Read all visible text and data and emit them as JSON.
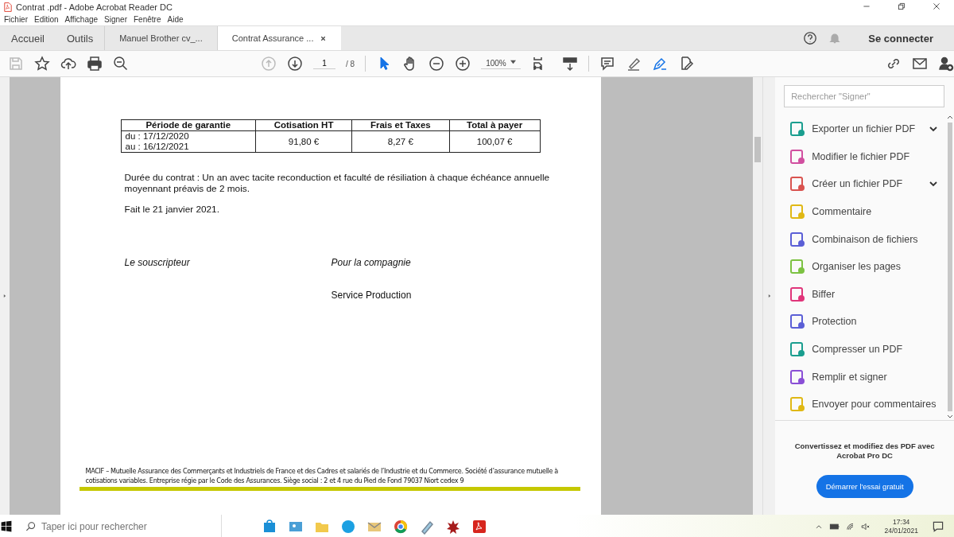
{
  "window": {
    "title": "Contrat .pdf - Adobe Acrobat Reader DC"
  },
  "menu": [
    "Fichier",
    "Edition",
    "Affichage",
    "Signer",
    "Fenêtre",
    "Aide"
  ],
  "tabs": [
    {
      "label": "Accueil",
      "kind": "home",
      "selected": false
    },
    {
      "label": "Outils",
      "kind": "home",
      "selected": false
    },
    {
      "label": "Manuel Brother cv_...",
      "kind": "doc",
      "selected": false
    },
    {
      "label": "Contrat Assurance ...",
      "kind": "doc",
      "selected": true
    }
  ],
  "account": {
    "sign_in": "Se connecter"
  },
  "toolbar": {
    "page": "1",
    "page_total": "/ 8",
    "zoom": "100%"
  },
  "document": {
    "table": {
      "columns": [
        "Période de garantie",
        "Cotisation HT",
        "Frais et Taxes",
        "Total à payer"
      ],
      "rows": [
        {
          "period": [
            "du : 17/12/2020",
            "au : 16/12/2021"
          ],
          "cotisation": "91,80 €",
          "frais": "8,27 €",
          "total": "100,07 €"
        }
      ]
    },
    "paragraphs": [
      "Durée du contrat : Un an avec tacite reconduction et faculté de résiliation à chaque échéance annuelle moyennant préavis de 2 mois.",
      "Fait le 21 janvier 2021."
    ],
    "signatures": {
      "left": "Le souscripteur",
      "right": "Pour la compagnie",
      "right_sub": "Service Production"
    },
    "footer": "MACIF – Mutuelle Assurance des Commerçants et Industriels de France et des Cadres et salariés de l’Industrie et du Commerce. Société d’assurance mutuelle à cotisations variables. Entreprise régie par le Code des Assurances. Siège social : 2 et 4 rue du Pied de Fond  79037 Niort cedex 9"
  },
  "tools_pane": {
    "search_placeholder": "Rechercher \"Signer\"",
    "tools": [
      {
        "label": "Exporter un fichier PDF",
        "color": "#1a9e8f",
        "expandable": true
      },
      {
        "label": "Modifier le fichier PDF",
        "color": "#d14fa0",
        "expandable": false
      },
      {
        "label": "Créer un fichier PDF",
        "color": "#d9534f",
        "expandable": true
      },
      {
        "label": "Commentaire",
        "color": "#e0b814",
        "expandable": false
      },
      {
        "label": "Combinaison de fichiers",
        "color": "#5b5fd6",
        "expandable": false
      },
      {
        "label": "Organiser les pages",
        "color": "#7cc242",
        "expandable": false
      },
      {
        "label": "Biffer",
        "color": "#e0357a",
        "expandable": false
      },
      {
        "label": "Protection",
        "color": "#5b5fd6",
        "expandable": false
      },
      {
        "label": "Compresser un PDF",
        "color": "#1a9e8f",
        "expandable": false
      },
      {
        "label": "Remplir et signer",
        "color": "#8a4fd6",
        "expandable": false
      },
      {
        "label": "Envoyer pour commentaires",
        "color": "#e0b814",
        "expandable": false
      }
    ],
    "promo": "Convertissez et modifiez des PDF avec Acrobat Pro DC",
    "cta": "Démarrer l'essai gratuit"
  },
  "taskbar": {
    "search_placeholder": "Taper ici pour rechercher",
    "time": "17:34",
    "date": "24/01/2021"
  }
}
